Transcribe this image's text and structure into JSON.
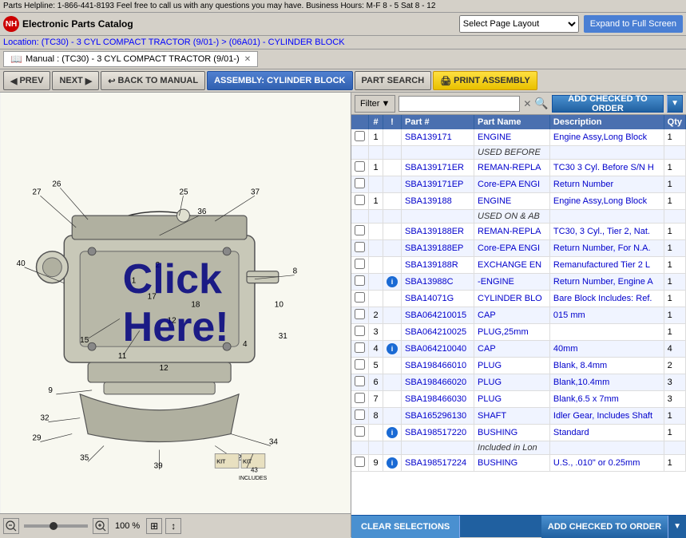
{
  "topBar": {
    "text": "Parts Helpline: 1-866-441-8193 Feel free to call us with any questions you may have. Business Hours: M-F 8 - 5 Sat 8 - 12"
  },
  "header": {
    "logoText": "NH",
    "appTitle": "Electronic Parts Catalog",
    "pageLayoutLabel": "Select Page Layout",
    "expandBtn": "Expand to Full Screen"
  },
  "location": {
    "text": "Location: (TC30) - 3 CYL COMPACT TRACTOR (9/01-) > (06A01) - CYLINDER BLOCK"
  },
  "tab": {
    "label": "Manual : (TC30) - 3 CYL COMPACT TRACTOR (9/01-)"
  },
  "toolbar": {
    "prevBtn": "PREV",
    "nextBtn": "NEXT",
    "backBtn": "BACK TO MANUAL",
    "assemblyBtn": "ASSEMBLY: CYLINDER BLOCK",
    "partSearchBtn": "PART SEARCH",
    "printBtn": "PRINT ASSEMBLY"
  },
  "filter": {
    "label": "Filter",
    "placeholder": "",
    "addCheckedBtn": "ADD CHECKED TO ORDER"
  },
  "tableHeaders": [
    "",
    "#",
    "!",
    "Part #",
    "Part Name",
    "Description",
    "Qty"
  ],
  "parts": [
    {
      "cb": true,
      "num": "1",
      "info": false,
      "partNum": "SBA139171",
      "partName": "ENGINE",
      "desc": "Engine Assy,Long Block",
      "qty": "1"
    },
    {
      "cb": false,
      "num": "",
      "info": false,
      "partNum": "",
      "partName": "USED BEFORE",
      "desc": "",
      "qty": ""
    },
    {
      "cb": true,
      "num": "1",
      "info": false,
      "partNum": "SBA139171ER",
      "partName": "REMAN-REPLA",
      "desc": "TC30 3 Cyl. Before S/N H",
      "qty": "1"
    },
    {
      "cb": true,
      "num": "",
      "info": false,
      "partNum": "SBA139171EP",
      "partName": "Core-EPA ENGI",
      "desc": "Return Number",
      "qty": "1"
    },
    {
      "cb": true,
      "num": "1",
      "info": false,
      "partNum": "SBA139188",
      "partName": "ENGINE",
      "desc": "Engine Assy,Long Block",
      "qty": "1"
    },
    {
      "cb": false,
      "num": "",
      "info": false,
      "partNum": "",
      "partName": "USED ON & AB",
      "desc": "",
      "qty": ""
    },
    {
      "cb": true,
      "num": "",
      "info": false,
      "partNum": "SBA139188ER",
      "partName": "REMAN-REPLA",
      "desc": "TC30, 3 Cyl., Tier 2, Nat.",
      "qty": "1"
    },
    {
      "cb": true,
      "num": "",
      "info": false,
      "partNum": "SBA139188EP",
      "partName": "Core-EPA ENGI",
      "desc": "Return Number, For N.A.",
      "qty": "1"
    },
    {
      "cb": true,
      "num": "",
      "info": false,
      "partNum": "SBA139188R",
      "partName": "EXCHANGE EN",
      "desc": "Remanufactured Tier 2 L",
      "qty": "1"
    },
    {
      "cb": true,
      "num": "",
      "info": true,
      "partNum": "SBA13988C",
      "partName": "-ENGINE",
      "desc": "Return Number, Engine A",
      "qty": "1"
    },
    {
      "cb": true,
      "num": "",
      "info": false,
      "partNum": "SBA14071G",
      "partName": "CYLINDER BLO",
      "desc": "Bare Block Includes: Ref.",
      "qty": "1"
    },
    {
      "cb": true,
      "num": "2",
      "info": false,
      "partNum": "SBA064210015",
      "partName": "CAP",
      "desc": "015 mm",
      "qty": "1"
    },
    {
      "cb": true,
      "num": "3",
      "info": false,
      "partNum": "SBA064210025",
      "partName": "PLUG,25mm",
      "desc": "",
      "qty": "1"
    },
    {
      "cb": true,
      "num": "4",
      "info": true,
      "partNum": "SBA064210040",
      "partName": "CAP",
      "desc": "40mm",
      "qty": "4"
    },
    {
      "cb": true,
      "num": "5",
      "info": false,
      "partNum": "SBA198466010",
      "partName": "PLUG",
      "desc": "Blank, 8.4mm",
      "qty": "2"
    },
    {
      "cb": true,
      "num": "6",
      "info": false,
      "partNum": "SBA198466020",
      "partName": "PLUG",
      "desc": "Blank,10.4mm",
      "qty": "3"
    },
    {
      "cb": true,
      "num": "7",
      "info": false,
      "partNum": "SBA198466030",
      "partName": "PLUG",
      "desc": "Blank,6.5 x 7mm",
      "qty": "3"
    },
    {
      "cb": true,
      "num": "8",
      "info": false,
      "partNum": "SBA165296130",
      "partName": "SHAFT",
      "desc": "Idler Gear, Includes Shaft",
      "qty": "1"
    },
    {
      "cb": true,
      "num": "",
      "info": true,
      "partNum": "SBA198517220",
      "partName": "BUSHING",
      "desc": "Standard",
      "qty": "1"
    },
    {
      "cb": false,
      "num": "",
      "info": false,
      "partNum": "",
      "partName": "Included in Lon",
      "desc": "",
      "qty": ""
    },
    {
      "cb": true,
      "num": "9",
      "info": true,
      "partNum": "SBA198517224",
      "partName": "BUSHING",
      "desc": "U.S., .010\" or 0.25mm",
      "qty": "1"
    }
  ],
  "bottom": {
    "clearBtn": "CLEAR SELECTIONS",
    "addBtn": "ADD CHECKED TO ORDER"
  },
  "zoom": {
    "pct": "100 %"
  },
  "clickHere": "Click Here!"
}
